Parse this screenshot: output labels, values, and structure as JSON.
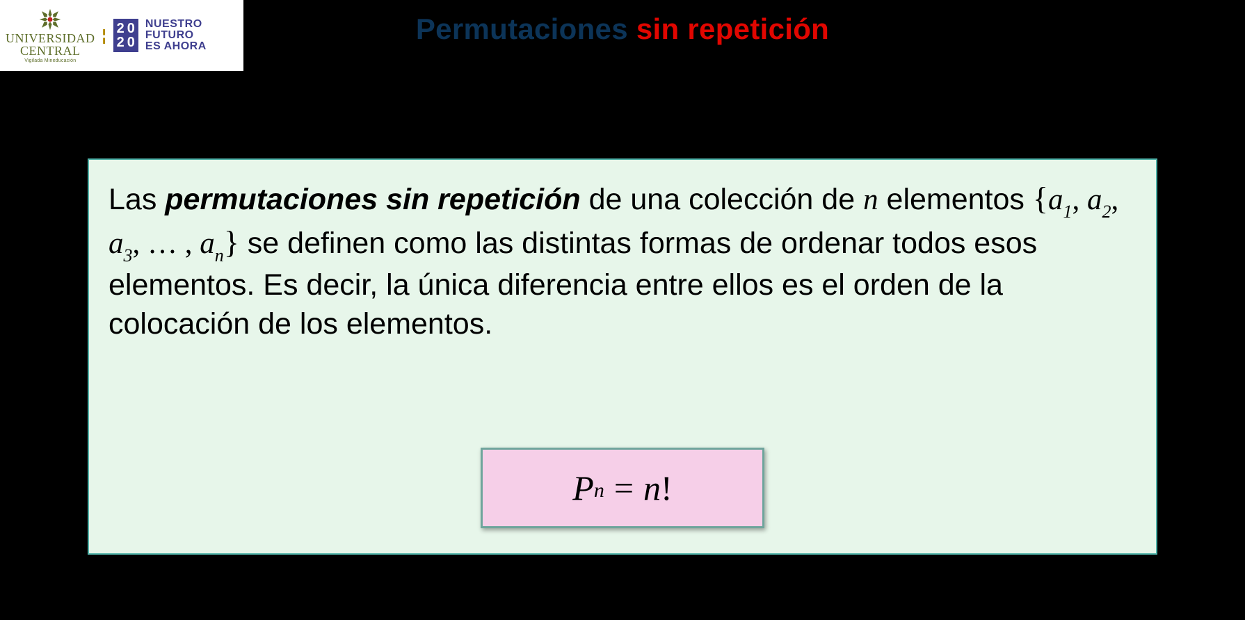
{
  "logo": {
    "university_name": "UNIVERSIDAD\nCENTRAL",
    "sub": "Vigilada Mineducación",
    "year_digits": [
      "2",
      "0",
      "2",
      "0"
    ],
    "campaign_line1": "NUESTRO",
    "campaign_line2": "FUTURO",
    "campaign_line3": "ES AHORA"
  },
  "title": {
    "part1": "Permutaciones ",
    "part2": "sin repetición"
  },
  "definition": {
    "prefix": "Las ",
    "lead": "permutaciones sin repetición",
    "after_lead": " de una colección de ",
    "n": "n",
    "elements_word": " elementos ",
    "set": "{a₁, a₂, a₃, … , aₙ}",
    "rest": " se definen como las distintas formas de ordenar todos esos elementos. Es decir, la única diferencia entre ellos es el orden de la colocación de los elementos."
  },
  "formula": {
    "P": "P",
    "sub_n": "n",
    "eq": "=",
    "n": "n",
    "bang": "!"
  }
}
